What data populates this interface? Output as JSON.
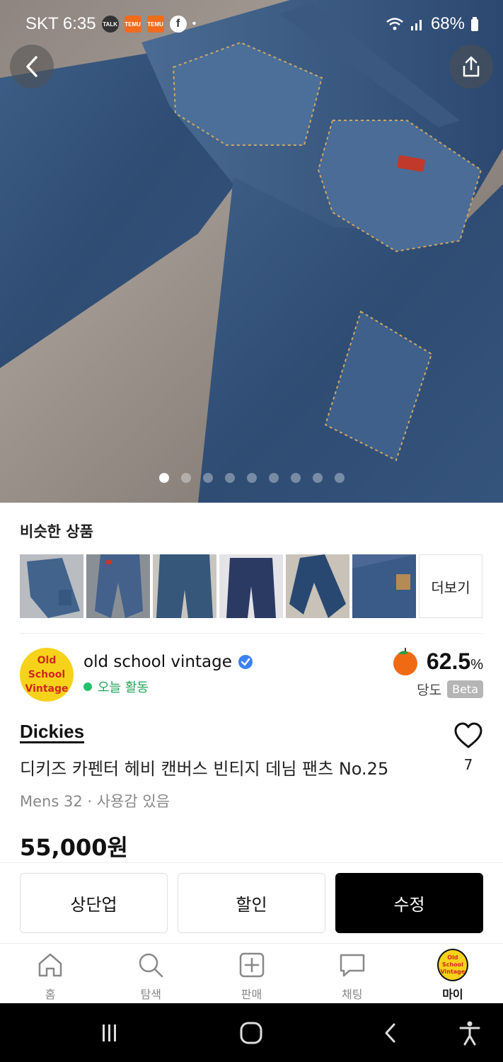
{
  "status_bar": {
    "carrier_time": "SKT 6:35",
    "battery": "68%",
    "icons": [
      "talk-icon",
      "temu-icon",
      "temu-icon",
      "facebook-icon",
      "dot-icon",
      "wifi-icon",
      "signal-icon",
      "battery-icon"
    ]
  },
  "hero": {
    "image_alt": "denim-carpenter-pants-photo",
    "dot_count": 9,
    "active_dot": 0
  },
  "similar": {
    "title": "비슷한 상품",
    "more_label": "더보기",
    "thumb_colors": [
      "#3f5a7c",
      "#5a6e8c",
      "#355273",
      "#2d3d63",
      "#2a4671",
      "#3d5b86"
    ]
  },
  "seller": {
    "avatar_text": [
      "Old",
      "School",
      "Vintage"
    ],
    "name": "old school vintage",
    "activity": "오늘 활동",
    "sweetness_value": "62.5",
    "sweetness_unit": "%",
    "sweetness_label": "당도",
    "beta_label": "Beta"
  },
  "product": {
    "brand": "Dickies",
    "title": "디키즈  카펜터 헤비 캔버스 빈티지 데님  팬츠 No.25",
    "meta": "Mens 32 · 사용감 있음",
    "price": "55,000원",
    "like_count": "7"
  },
  "actions": {
    "bump_label": "상단업",
    "discount_label": "할인",
    "edit_label": "수정"
  },
  "bottom_nav": {
    "home": "홈",
    "search": "탐색",
    "sell": "판매",
    "chat": "채팅",
    "my": "마이"
  },
  "colors": {
    "accent_green": "#23c06b",
    "primary_button": "#000000",
    "avatar_yellow": "#f7d21a",
    "avatar_red": "#d0281e"
  }
}
